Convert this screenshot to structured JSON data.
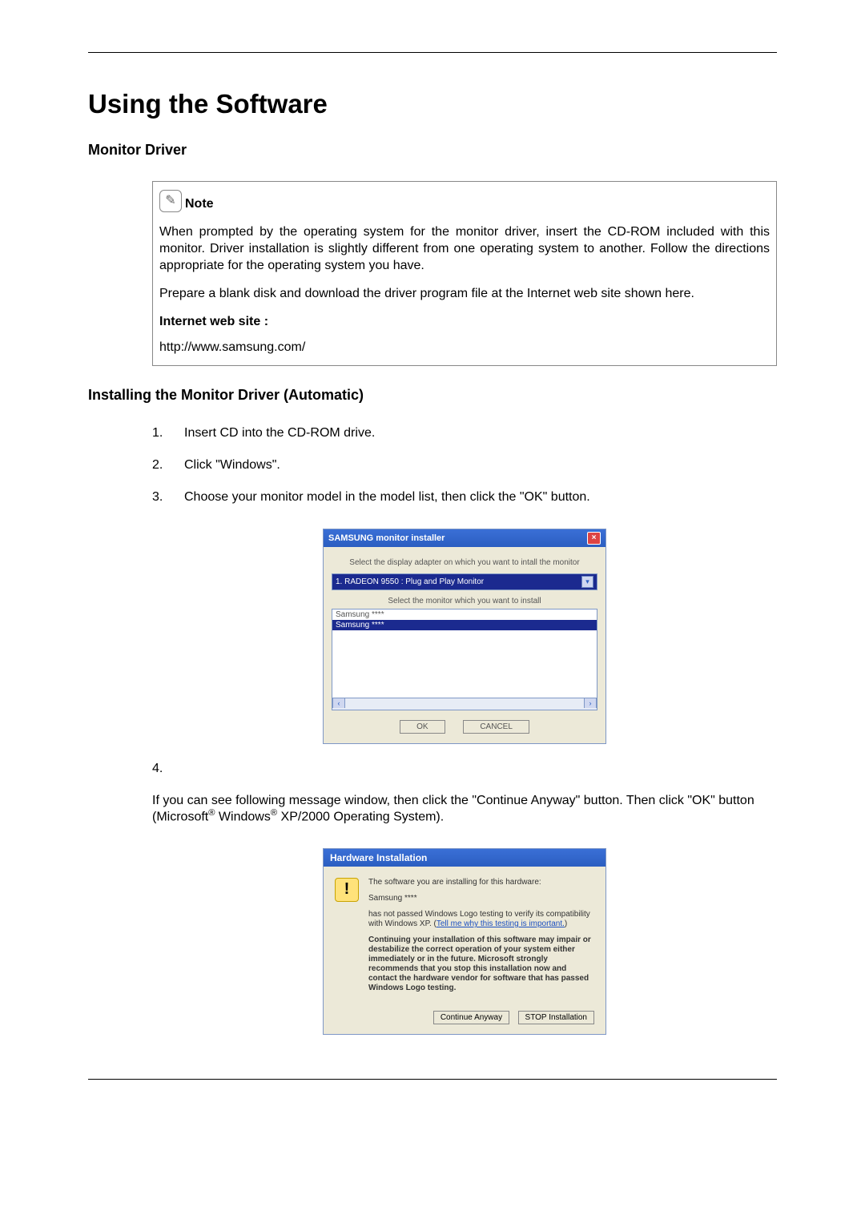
{
  "title": "Using the Software",
  "section1": "Monitor Driver",
  "note": {
    "label": "Note",
    "p1": "When prompted by the operating system for the monitor driver, insert the CD-ROM included with this monitor. Driver installation is slightly different from one operating system to another. Follow the directions appropriate for the operating system you have.",
    "p2": "Prepare a blank disk and download the driver program file at the Internet web site shown here.",
    "label2": "Internet web site :",
    "url": "http://www.samsung.com/"
  },
  "section2": "Installing the Monitor Driver (Automatic)",
  "steps": {
    "n1": "1.",
    "s1": "Insert CD into the CD-ROM drive.",
    "n2": "2.",
    "s2": "Click \"Windows\".",
    "n3": "3.",
    "s3": "Choose your monitor model in the model list, then click the \"OK\" button.",
    "n4": "4.",
    "s4a": "If you can see following message window, then click the \"Continue Anyway\" button. Then click \"OK\" button (Microsoft",
    "s4b": " Windows",
    "s4c": " XP/2000 Operating System).",
    "reg": "®"
  },
  "installer": {
    "title": "SAMSUNG monitor installer",
    "instr1": "Select the display adapter on which you want to intall the monitor",
    "adapter": "1. RADEON 9550 : Plug and Play Monitor",
    "instr2": "Select the monitor which you want to install",
    "row1": "Samsung ****",
    "row2": "Samsung ****",
    "ok": "OK",
    "cancel": "CANCEL"
  },
  "hw": {
    "title": "Hardware Installation",
    "bang": "!",
    "l1": "The software you are installing for this hardware:",
    "l2": "Samsung ****",
    "l3a": "has not passed Windows Logo testing to verify its compatibility with Windows XP. (",
    "link": "Tell me why this testing is important.",
    "l3b": ")",
    "l4": "Continuing your installation of this software may impair or destabilize the correct operation of your system either immediately or in the future. Microsoft strongly recommends that you stop this installation now and contact the hardware vendor for software that has passed Windows Logo testing.",
    "cont": "Continue Anyway",
    "stop": "STOP Installation"
  }
}
